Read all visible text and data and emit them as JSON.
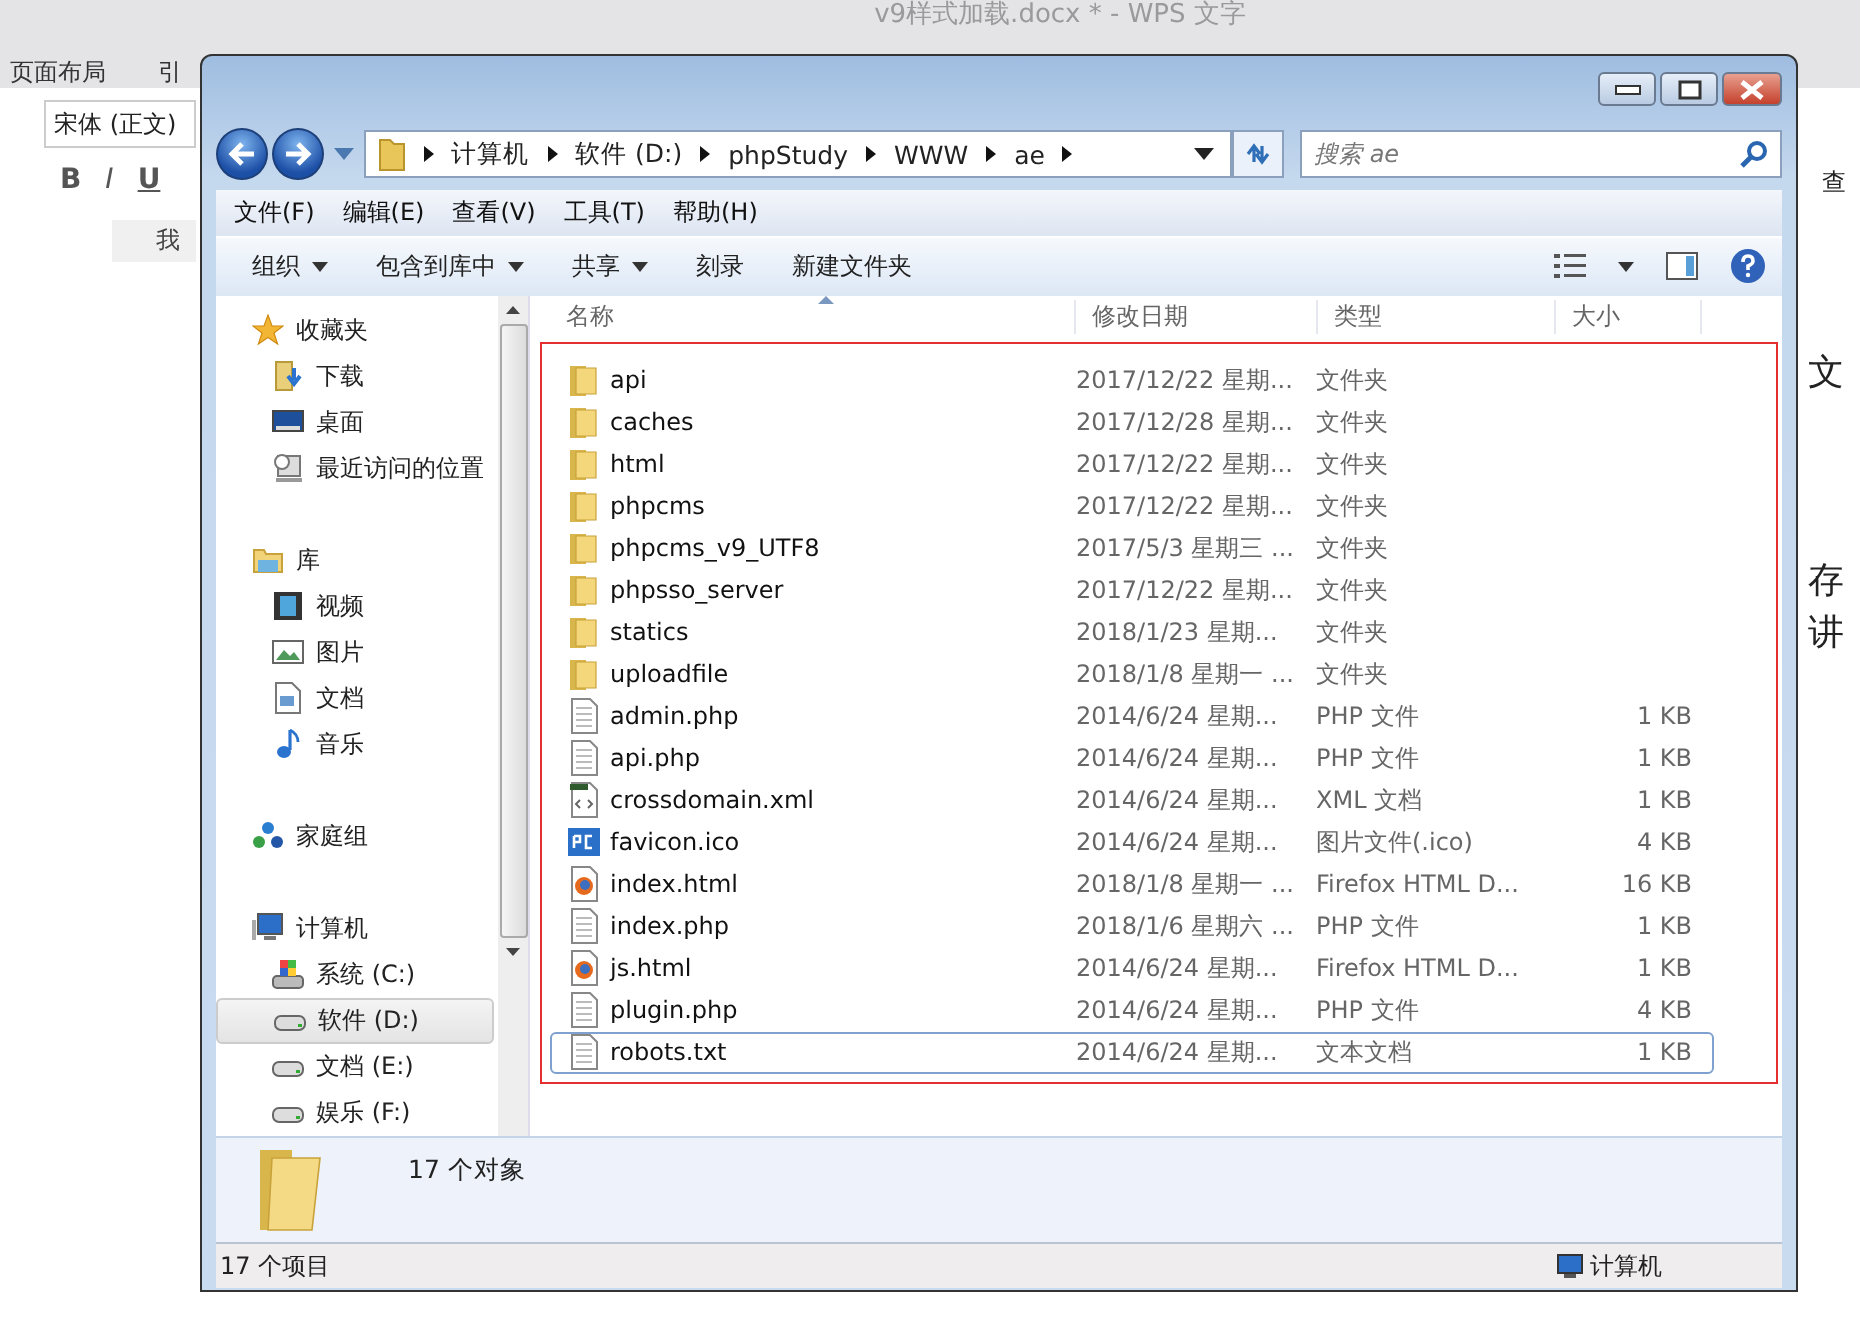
{
  "background_app": {
    "title": "v9样式加载.docx * - WPS 文字",
    "tabs": [
      "页面布局",
      "引"
    ],
    "font_name": "宋体 (正文)",
    "format_buttons": [
      "B",
      "I",
      "U"
    ],
    "doc_tab": "我",
    "find_label": "查",
    "doc_fragments": [
      "文",
      "存",
      "讲"
    ]
  },
  "window": {
    "address": {
      "segments": [
        "计算机",
        "软件 (D:)",
        "phpStudy",
        "WWW",
        "ae"
      ]
    },
    "search": {
      "placeholder": "搜索 ae"
    },
    "menu": [
      "文件(F)",
      "编辑(E)",
      "查看(V)",
      "工具(T)",
      "帮助(H)"
    ],
    "toolbar": [
      {
        "label": "组织",
        "dropdown": true
      },
      {
        "label": "包含到库中",
        "dropdown": true
      },
      {
        "label": "共享",
        "dropdown": true
      },
      {
        "label": "刻录",
        "dropdown": false
      },
      {
        "label": "新建文件夹",
        "dropdown": false
      }
    ],
    "nav": [
      {
        "label": "收藏夹",
        "kind": "star",
        "selected": false,
        "children": [
          {
            "label": "下载",
            "kind": "download",
            "selected": false
          },
          {
            "label": "桌面",
            "kind": "desktop",
            "selected": false
          },
          {
            "label": "最近访问的位置",
            "kind": "recent",
            "selected": false
          }
        ]
      },
      {
        "label": "库",
        "kind": "library",
        "selected": false,
        "children": [
          {
            "label": "视频",
            "kind": "video",
            "selected": false
          },
          {
            "label": "图片",
            "kind": "picture",
            "selected": false
          },
          {
            "label": "文档",
            "kind": "doc",
            "selected": false
          },
          {
            "label": "音乐",
            "kind": "music",
            "selected": false
          }
        ]
      },
      {
        "label": "家庭组",
        "kind": "homegroup",
        "selected": false
      },
      {
        "label": "计算机",
        "kind": "computer",
        "selected": false,
        "children": [
          {
            "label": "系统 (C:)",
            "kind": "sysdrive",
            "selected": false
          },
          {
            "label": "软件 (D:)",
            "kind": "drive",
            "selected": true
          },
          {
            "label": "文档 (E:)",
            "kind": "drive",
            "selected": false
          },
          {
            "label": "娱乐 (F:)",
            "kind": "drive",
            "selected": false
          }
        ]
      }
    ],
    "columns": [
      "名称",
      "修改日期",
      "类型",
      "大小"
    ],
    "files": [
      {
        "name": "api",
        "date": "2017/12/22 星期...",
        "type": "文件夹",
        "kind": "folder",
        "selected": false
      },
      {
        "name": "caches",
        "date": "2017/12/28 星期...",
        "type": "文件夹",
        "kind": "folder",
        "selected": false
      },
      {
        "name": "html",
        "date": "2017/12/22 星期...",
        "type": "文件夹",
        "kind": "folder",
        "selected": false
      },
      {
        "name": "phpcms",
        "date": "2017/12/22 星期...",
        "type": "文件夹",
        "kind": "folder",
        "selected": false
      },
      {
        "name": "phpcms_v9_UTF8",
        "date": "2017/5/3 星期三 ...",
        "type": "文件夹",
        "kind": "folder",
        "selected": false
      },
      {
        "name": "phpsso_server",
        "date": "2017/12/22 星期...",
        "type": "文件夹",
        "kind": "folder",
        "selected": false
      },
      {
        "name": "statics",
        "date": "2018/1/23 星期...",
        "type": "文件夹",
        "kind": "folder",
        "selected": false
      },
      {
        "name": "uploadfile",
        "date": "2018/1/8 星期一 ...",
        "type": "文件夹",
        "kind": "folder",
        "selected": false
      },
      {
        "name": "admin.php",
        "date": "2014/6/24 星期...",
        "type": "PHP 文件",
        "size": "1 KB",
        "kind": "file",
        "selected": false
      },
      {
        "name": "api.php",
        "date": "2014/6/24 星期...",
        "type": "PHP 文件",
        "size": "1 KB",
        "kind": "file",
        "selected": false
      },
      {
        "name": "crossdomain.xml",
        "date": "2014/6/24 星期...",
        "type": "XML 文档",
        "size": "1 KB",
        "kind": "xml",
        "selected": false
      },
      {
        "name": "favicon.ico",
        "date": "2014/6/24 星期...",
        "type": "图片文件(.ico)",
        "size": "4 KB",
        "kind": "ico",
        "selected": false
      },
      {
        "name": "index.html",
        "date": "2018/1/8 星期一 ...",
        "type": "Firefox HTML D...",
        "size": "16 KB",
        "kind": "firefox",
        "selected": false
      },
      {
        "name": "index.php",
        "date": "2018/1/6 星期六 ...",
        "type": "PHP 文件",
        "size": "1 KB",
        "kind": "file",
        "selected": false
      },
      {
        "name": "js.html",
        "date": "2014/6/24 星期...",
        "type": "Firefox HTML D...",
        "size": "1 KB",
        "kind": "firefox",
        "selected": false
      },
      {
        "name": "plugin.php",
        "date": "2014/6/24 星期...",
        "type": "PHP 文件",
        "size": "4 KB",
        "kind": "file",
        "selected": false
      },
      {
        "name": "robots.txt",
        "date": "2014/6/24 星期...",
        "type": "文本文档",
        "size": "1 KB",
        "kind": "file",
        "selected": true
      }
    ],
    "details": "17 个对象",
    "status": {
      "count": "17 个项目",
      "location": "计算机"
    }
  }
}
